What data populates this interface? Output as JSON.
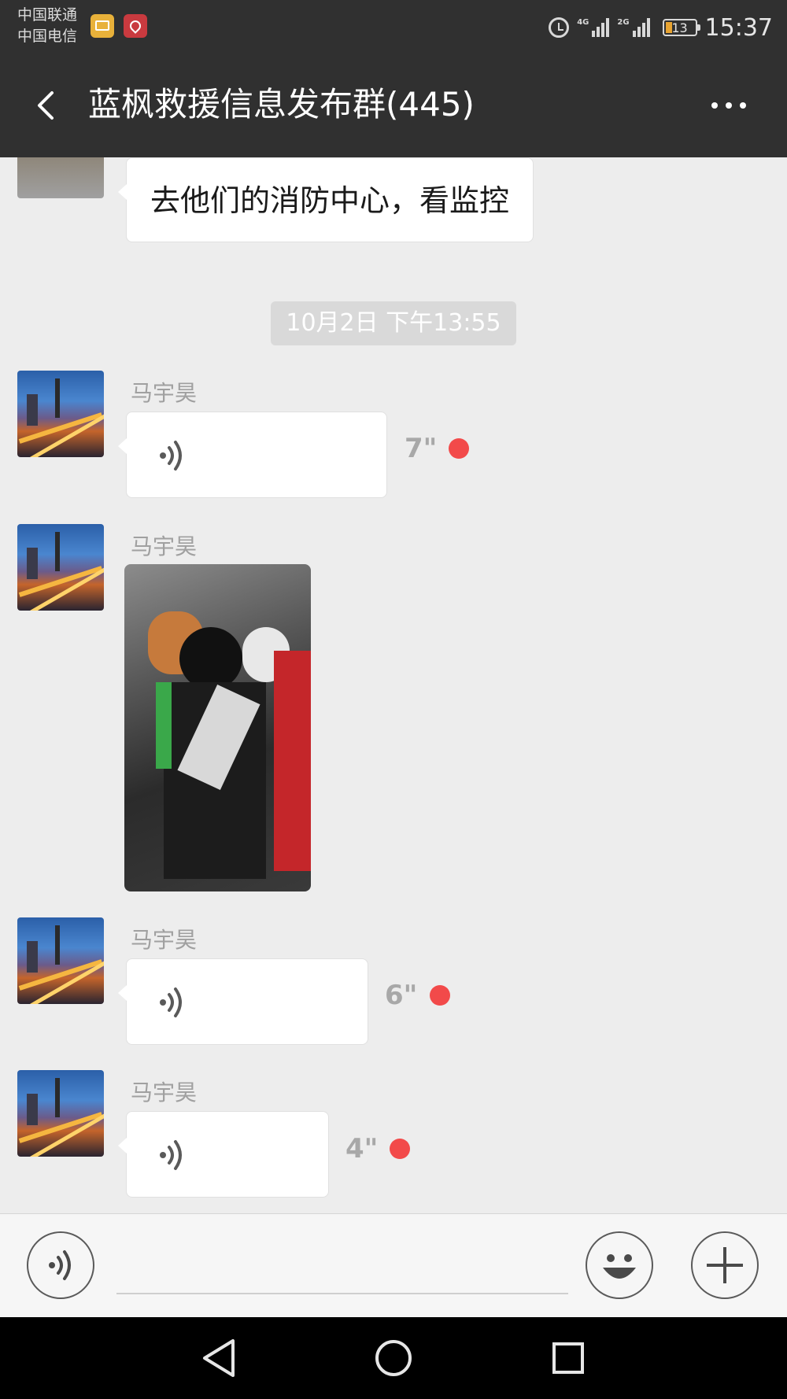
{
  "status_bar": {
    "carrier1": "中国联通",
    "carrier2": "中国电信",
    "network1": "4G",
    "network2": "2G",
    "battery": "13",
    "time": "15:37"
  },
  "header": {
    "title": "蓝枫救援信息发布群(445)"
  },
  "messages": [
    {
      "type": "text",
      "text": "去他们的消防中心，看监控"
    },
    {
      "type": "timestamp",
      "text": "10月2日 下午13:55"
    },
    {
      "type": "voice",
      "sender": "马宇昊",
      "duration": "7\"",
      "unread": true
    },
    {
      "type": "image",
      "sender": "马宇昊"
    },
    {
      "type": "voice",
      "sender": "马宇昊",
      "duration": "6\"",
      "unread": true
    },
    {
      "type": "voice",
      "sender": "马宇昊",
      "duration": "4\"",
      "unread": true
    }
  ],
  "colors": {
    "header_bg": "#303030",
    "chat_bg": "#ededed",
    "unread_dot": "#f24a4a"
  }
}
